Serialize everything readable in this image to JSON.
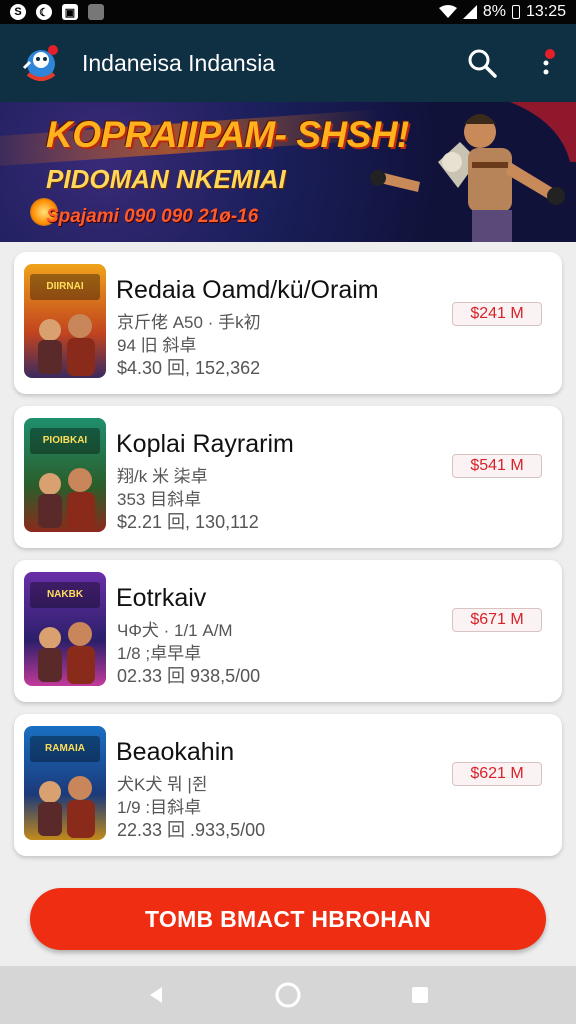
{
  "status_bar": {
    "battery_text": "8%",
    "time": "13:25",
    "icons": [
      "notification-s-icon",
      "notification-moon-icon",
      "image-icon",
      "notification-box-icon",
      "wifi-icon",
      "signal-icon"
    ]
  },
  "app_bar": {
    "title": "Indaneisa Indansia",
    "logo_icon": "mascot-logo-icon",
    "search_icon": "search-icon",
    "menu_icon": "more-vertical-icon",
    "menu_dot_color": "#e3202a"
  },
  "banner": {
    "title": "KOPRAIIPAM- SHSH!",
    "subtitle": "PIDOMAN NKEMIAI",
    "date_line": "Spajami 090 090 21ø-16"
  },
  "games": [
    {
      "name": "Redaia Oamd/kü/Oraim",
      "meta1": "京斤佬 A50 · 手k初",
      "meta2": "94 旧 斜卓",
      "meta3": "$4.30 回, 152,362",
      "price": "$241 M",
      "thumb_title": "DIIRNAI",
      "thumb_colors": [
        "#f0a21b",
        "#c2451e",
        "#3a2a60"
      ]
    },
    {
      "name": "Koplai Rayrarim",
      "meta1": "翔/k 米 柒卓",
      "meta2": "353 目斜卓",
      "meta3": "$2.21 回, 130,112",
      "price": "$541 M",
      "thumb_title": "PIOIBKAI",
      "thumb_colors": [
        "#1f8f6e",
        "#2b5d2a",
        "#8c2a1c"
      ]
    },
    {
      "name": "Eotrkaiv",
      "meta1": "ЧΦ犬 · 1/1 A/M",
      "meta2": "1/8 ;卓早卓",
      "meta3": "02.33 回 938,5/00",
      "price": "$671 M",
      "thumb_title": "NAKBK",
      "thumb_colors": [
        "#6a2fa8",
        "#2b1f6a",
        "#c23a9a"
      ]
    },
    {
      "name": "Beaokahin",
      "meta1": "犬Κ犬 뭐 |쥔",
      "meta2": "1/9 :目斜卓",
      "meta3": "22.33 回 .933,5/00",
      "price": "$621 M",
      "thumb_title": "RAMAIA",
      "thumb_colors": [
        "#1a6fc2",
        "#1b3a7a",
        "#c28a1a"
      ]
    }
  ],
  "main_button": {
    "label": "TOMB BMACT HBROHAN",
    "color": "#ef2d12"
  },
  "nav_bar": {
    "icons": [
      "back-icon",
      "home-icon",
      "recents-icon"
    ]
  }
}
